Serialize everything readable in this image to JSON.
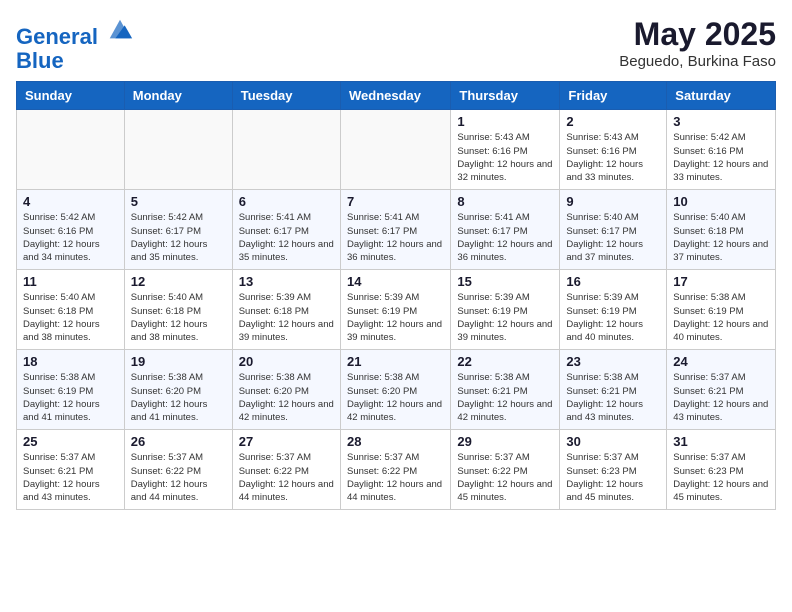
{
  "header": {
    "logo_line1": "General",
    "logo_line2": "Blue",
    "month_title": "May 2025",
    "subtitle": "Beguedo, Burkina Faso"
  },
  "weekdays": [
    "Sunday",
    "Monday",
    "Tuesday",
    "Wednesday",
    "Thursday",
    "Friday",
    "Saturday"
  ],
  "weeks": [
    [
      {
        "day": "",
        "info": ""
      },
      {
        "day": "",
        "info": ""
      },
      {
        "day": "",
        "info": ""
      },
      {
        "day": "",
        "info": ""
      },
      {
        "day": "1",
        "info": "Sunrise: 5:43 AM\nSunset: 6:16 PM\nDaylight: 12 hours\nand 32 minutes."
      },
      {
        "day": "2",
        "info": "Sunrise: 5:43 AM\nSunset: 6:16 PM\nDaylight: 12 hours\nand 33 minutes."
      },
      {
        "day": "3",
        "info": "Sunrise: 5:42 AM\nSunset: 6:16 PM\nDaylight: 12 hours\nand 33 minutes."
      }
    ],
    [
      {
        "day": "4",
        "info": "Sunrise: 5:42 AM\nSunset: 6:16 PM\nDaylight: 12 hours\nand 34 minutes."
      },
      {
        "day": "5",
        "info": "Sunrise: 5:42 AM\nSunset: 6:17 PM\nDaylight: 12 hours\nand 35 minutes."
      },
      {
        "day": "6",
        "info": "Sunrise: 5:41 AM\nSunset: 6:17 PM\nDaylight: 12 hours\nand 35 minutes."
      },
      {
        "day": "7",
        "info": "Sunrise: 5:41 AM\nSunset: 6:17 PM\nDaylight: 12 hours\nand 36 minutes."
      },
      {
        "day": "8",
        "info": "Sunrise: 5:41 AM\nSunset: 6:17 PM\nDaylight: 12 hours\nand 36 minutes."
      },
      {
        "day": "9",
        "info": "Sunrise: 5:40 AM\nSunset: 6:17 PM\nDaylight: 12 hours\nand 37 minutes."
      },
      {
        "day": "10",
        "info": "Sunrise: 5:40 AM\nSunset: 6:18 PM\nDaylight: 12 hours\nand 37 minutes."
      }
    ],
    [
      {
        "day": "11",
        "info": "Sunrise: 5:40 AM\nSunset: 6:18 PM\nDaylight: 12 hours\nand 38 minutes."
      },
      {
        "day": "12",
        "info": "Sunrise: 5:40 AM\nSunset: 6:18 PM\nDaylight: 12 hours\nand 38 minutes."
      },
      {
        "day": "13",
        "info": "Sunrise: 5:39 AM\nSunset: 6:18 PM\nDaylight: 12 hours\nand 39 minutes."
      },
      {
        "day": "14",
        "info": "Sunrise: 5:39 AM\nSunset: 6:19 PM\nDaylight: 12 hours\nand 39 minutes."
      },
      {
        "day": "15",
        "info": "Sunrise: 5:39 AM\nSunset: 6:19 PM\nDaylight: 12 hours\nand 39 minutes."
      },
      {
        "day": "16",
        "info": "Sunrise: 5:39 AM\nSunset: 6:19 PM\nDaylight: 12 hours\nand 40 minutes."
      },
      {
        "day": "17",
        "info": "Sunrise: 5:38 AM\nSunset: 6:19 PM\nDaylight: 12 hours\nand 40 minutes."
      }
    ],
    [
      {
        "day": "18",
        "info": "Sunrise: 5:38 AM\nSunset: 6:19 PM\nDaylight: 12 hours\nand 41 minutes."
      },
      {
        "day": "19",
        "info": "Sunrise: 5:38 AM\nSunset: 6:20 PM\nDaylight: 12 hours\nand 41 minutes."
      },
      {
        "day": "20",
        "info": "Sunrise: 5:38 AM\nSunset: 6:20 PM\nDaylight: 12 hours\nand 42 minutes."
      },
      {
        "day": "21",
        "info": "Sunrise: 5:38 AM\nSunset: 6:20 PM\nDaylight: 12 hours\nand 42 minutes."
      },
      {
        "day": "22",
        "info": "Sunrise: 5:38 AM\nSunset: 6:21 PM\nDaylight: 12 hours\nand 42 minutes."
      },
      {
        "day": "23",
        "info": "Sunrise: 5:38 AM\nSunset: 6:21 PM\nDaylight: 12 hours\nand 43 minutes."
      },
      {
        "day": "24",
        "info": "Sunrise: 5:37 AM\nSunset: 6:21 PM\nDaylight: 12 hours\nand 43 minutes."
      }
    ],
    [
      {
        "day": "25",
        "info": "Sunrise: 5:37 AM\nSunset: 6:21 PM\nDaylight: 12 hours\nand 43 minutes."
      },
      {
        "day": "26",
        "info": "Sunrise: 5:37 AM\nSunset: 6:22 PM\nDaylight: 12 hours\nand 44 minutes."
      },
      {
        "day": "27",
        "info": "Sunrise: 5:37 AM\nSunset: 6:22 PM\nDaylight: 12 hours\nand 44 minutes."
      },
      {
        "day": "28",
        "info": "Sunrise: 5:37 AM\nSunset: 6:22 PM\nDaylight: 12 hours\nand 44 minutes."
      },
      {
        "day": "29",
        "info": "Sunrise: 5:37 AM\nSunset: 6:22 PM\nDaylight: 12 hours\nand 45 minutes."
      },
      {
        "day": "30",
        "info": "Sunrise: 5:37 AM\nSunset: 6:23 PM\nDaylight: 12 hours\nand 45 minutes."
      },
      {
        "day": "31",
        "info": "Sunrise: 5:37 AM\nSunset: 6:23 PM\nDaylight: 12 hours\nand 45 minutes."
      }
    ]
  ]
}
